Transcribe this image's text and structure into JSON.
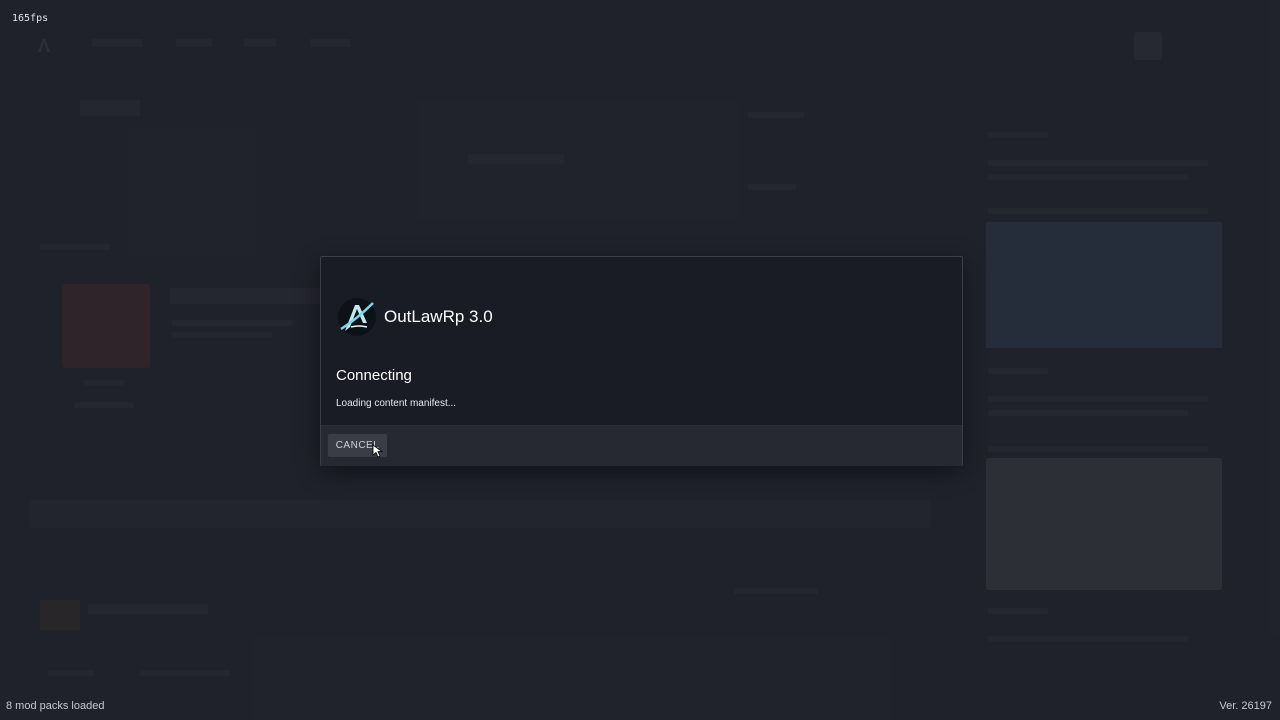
{
  "fps_counter": "165fps",
  "dialog": {
    "server_title": "OutLawRp 3.0",
    "status_title": "Connecting",
    "status_message": "Loading content manifest...",
    "cancel_label": "CANCEL"
  },
  "status_bar": {
    "mod_packs": "8 mod packs loaded",
    "version": "Ver. 26197"
  },
  "colors": {
    "background": "#262833",
    "dialog": "#191b25",
    "dialog_footer": "#262832",
    "server_icon_accent": "#7fd6e6"
  },
  "icons": {
    "server_logo": "outlaw-rp-logo",
    "pointer": "mouse-cursor-icon"
  }
}
